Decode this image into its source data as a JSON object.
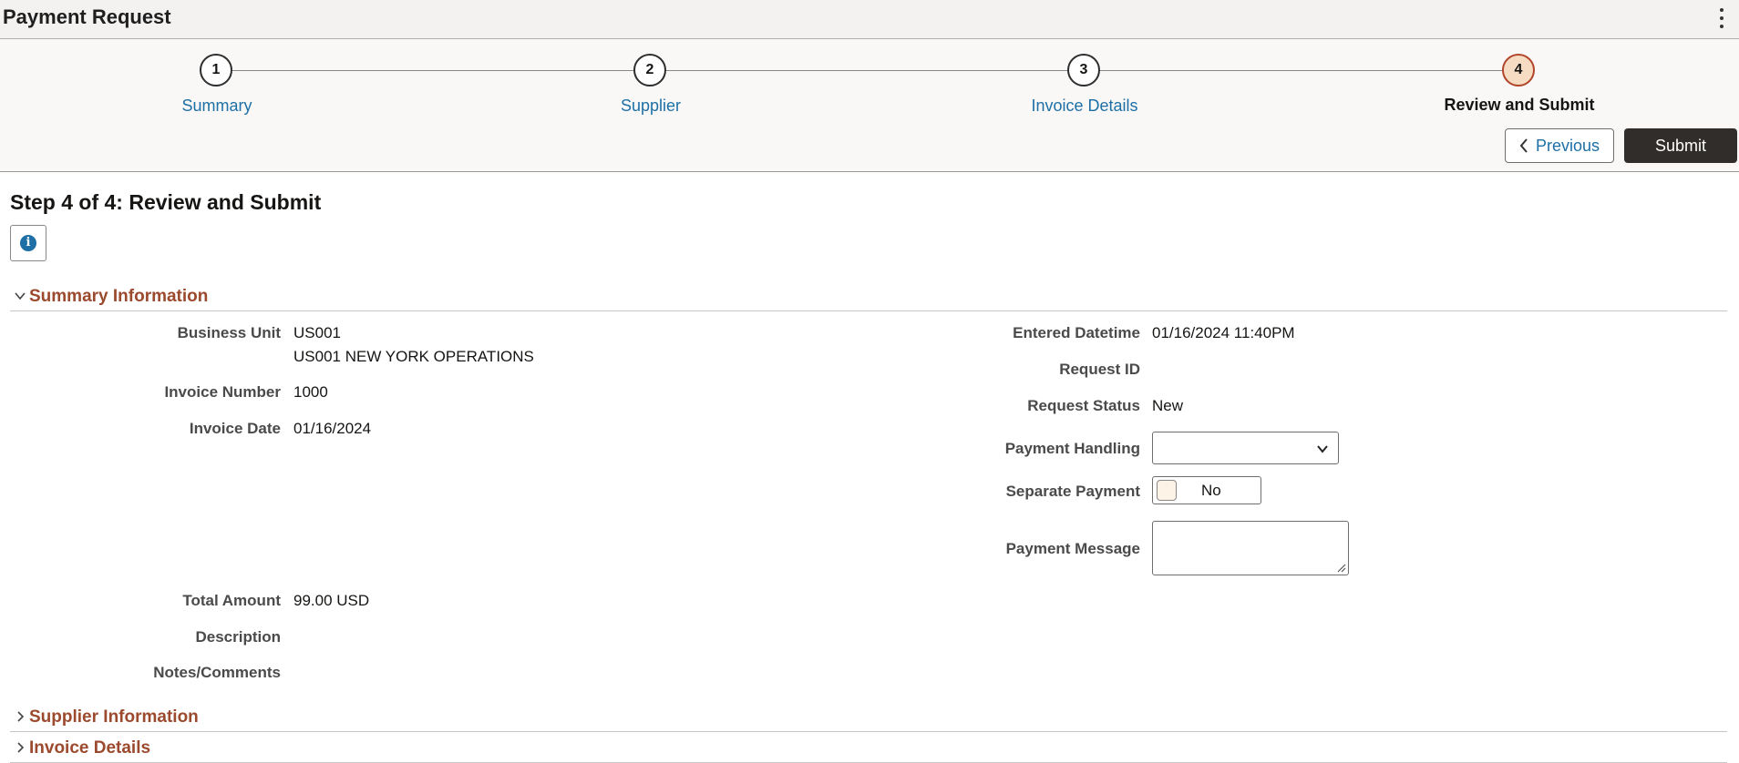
{
  "header": {
    "title": "Payment Request",
    "menu_icon": "kebab-menu-icon"
  },
  "train": {
    "steps": [
      {
        "number": "1",
        "label": "Summary",
        "state": "link"
      },
      {
        "number": "2",
        "label": "Supplier",
        "state": "link"
      },
      {
        "number": "3",
        "label": "Invoice Details",
        "state": "link"
      },
      {
        "number": "4",
        "label": "Review and Submit",
        "state": "current"
      }
    ],
    "previous_label": "Previous",
    "submit_label": "Submit"
  },
  "page": {
    "step_heading": "Step 4 of 4: Review and Submit",
    "info_icon": "info-icon"
  },
  "sections": {
    "summary": {
      "title": "Summary Information",
      "expanded": true,
      "business_unit_label": "Business Unit",
      "business_unit_value": "US001",
      "business_unit_desc": "US001 NEW YORK OPERATIONS",
      "invoice_number_label": "Invoice Number",
      "invoice_number_value": "1000",
      "invoice_date_label": "Invoice Date",
      "invoice_date_value": "01/16/2024",
      "total_amount_label": "Total Amount",
      "total_amount_value": "99.00 USD",
      "description_label": "Description",
      "notes_label": "Notes/Comments",
      "entered_datetime_label": "Entered Datetime",
      "entered_datetime_value": "01/16/2024 11:40PM",
      "request_id_label": "Request ID",
      "request_status_label": "Request Status",
      "request_status_value": "New",
      "payment_handling_label": "Payment Handling",
      "payment_handling_value": "",
      "separate_payment_label": "Separate Payment",
      "separate_payment_value": "No",
      "payment_message_label": "Payment Message",
      "payment_message_value": ""
    },
    "supplier": {
      "title": "Supplier Information",
      "expanded": false
    },
    "invoice": {
      "title": "Invoice Details",
      "expanded": false
    }
  },
  "colors": {
    "link": "#1d6fa5",
    "section_title": "#9b4a2d",
    "current_step_fill": "#f5dcc2",
    "submit_bg": "#312d2a"
  }
}
